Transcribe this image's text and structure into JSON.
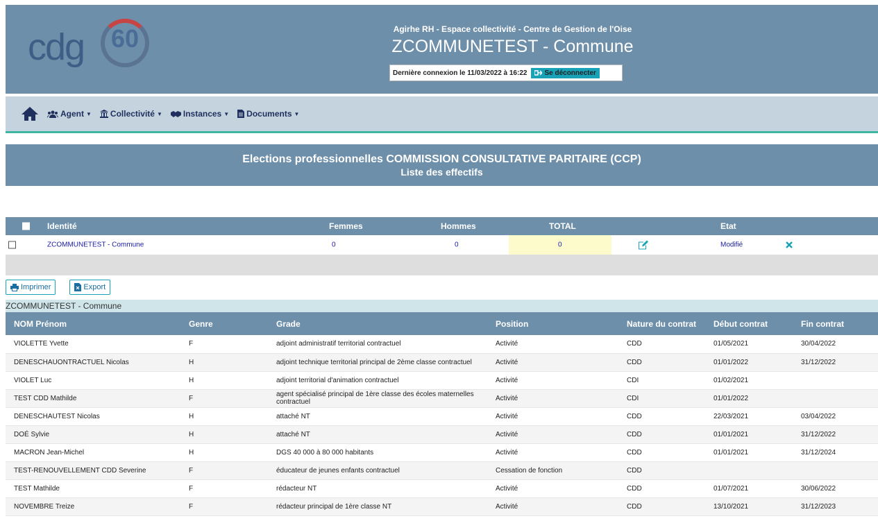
{
  "header": {
    "logo": {
      "text": "cdg",
      "number": "60"
    },
    "subtitle": "Agirhe RH - Espace collectivité - Centre de Gestion de l'Oise",
    "title": "ZCOMMUNETEST - Commune",
    "last_login": "Dernière connexion le 11/03/2022 à 16:22",
    "logout_label": "Se déconnecter"
  },
  "nav": {
    "items": [
      {
        "label": "Agent",
        "icon": "users-icon"
      },
      {
        "label": "Collectivité",
        "icon": "institution-icon"
      },
      {
        "label": "Instances",
        "icon": "handshake-icon"
      },
      {
        "label": "Documents",
        "icon": "file-icon"
      }
    ]
  },
  "page": {
    "title_line1": "Elections professionnelles COMMISSION CONSULTATIVE PARITAIRE (CCP)",
    "title_line2": "Liste des effectifs"
  },
  "summary": {
    "headers": {
      "identite": "Identité",
      "femmes": "Femmes",
      "hommes": "Hommes",
      "total": "TOTAL",
      "etat": "Etat"
    },
    "row": {
      "identite": "ZCOMMUNETEST - Commune",
      "femmes": "0",
      "hommes": "0",
      "total": "0",
      "etat": "Modifié"
    }
  },
  "actions": {
    "print_label": "Imprimer",
    "export_label": "Export"
  },
  "group_label": "ZCOMMUNETEST - Commune",
  "agents": {
    "columns": [
      "NOM Prénom",
      "Genre",
      "Grade",
      "Position",
      "Nature du contrat",
      "Début contrat",
      "Fin contrat"
    ],
    "rows": [
      [
        "VIOLETTE Yvette",
        "F",
        "adjoint administratif territorial contractuel",
        "Activité",
        "CDD",
        "01/05/2021",
        "30/04/2022"
      ],
      [
        "DENESCHAUONTRACTUEL Nicolas",
        "H",
        "adjoint technique territorial principal de 2ème classe contractuel",
        "Activité",
        "CDD",
        "01/01/2022",
        "31/12/2022"
      ],
      [
        "VIOLET Luc",
        "H",
        "adjoint territorial d'animation contractuel",
        "Activité",
        "CDI",
        "01/02/2021",
        ""
      ],
      [
        "TEST CDD Mathilde",
        "F",
        "agent spécialisé principal de 1ère classe des écoles maternelles contractuel",
        "Activité",
        "CDI",
        "01/01/2022",
        ""
      ],
      [
        "DENESCHAUTEST Nicolas",
        "H",
        "attaché NT",
        "Activité",
        "CDD",
        "22/03/2021",
        "03/04/2022"
      ],
      [
        "DOÉ Sylvie",
        "H",
        "attaché NT",
        "Activité",
        "CDD",
        "01/01/2021",
        "31/12/2022"
      ],
      [
        "MACRON Jean-Michel",
        "H",
        "DGS 40 000 à 80 000 habitants",
        "Activité",
        "CDD",
        "01/01/2021",
        "31/12/2024"
      ],
      [
        "TEST-RENOUVELLEMENT CDD Severine",
        "F",
        "éducateur de jeunes enfants contractuel",
        "Cessation de fonction",
        "CDD",
        "",
        ""
      ],
      [
        "TEST Mathilde",
        "F",
        "rédacteur NT",
        "Activité",
        "CDD",
        "01/07/2021",
        "30/06/2022"
      ],
      [
        "NOVEMBRE Treize",
        "F",
        "rédacteur principal de 1ère classe NT",
        "Activité",
        "CDD",
        "13/10/2021",
        "31/12/2023"
      ]
    ]
  },
  "colors": {
    "header_bg": "#6e8faa",
    "nav_bg": "#c5d3de",
    "accent": "#17a2b8",
    "total_bg": "#fdfbcc"
  }
}
